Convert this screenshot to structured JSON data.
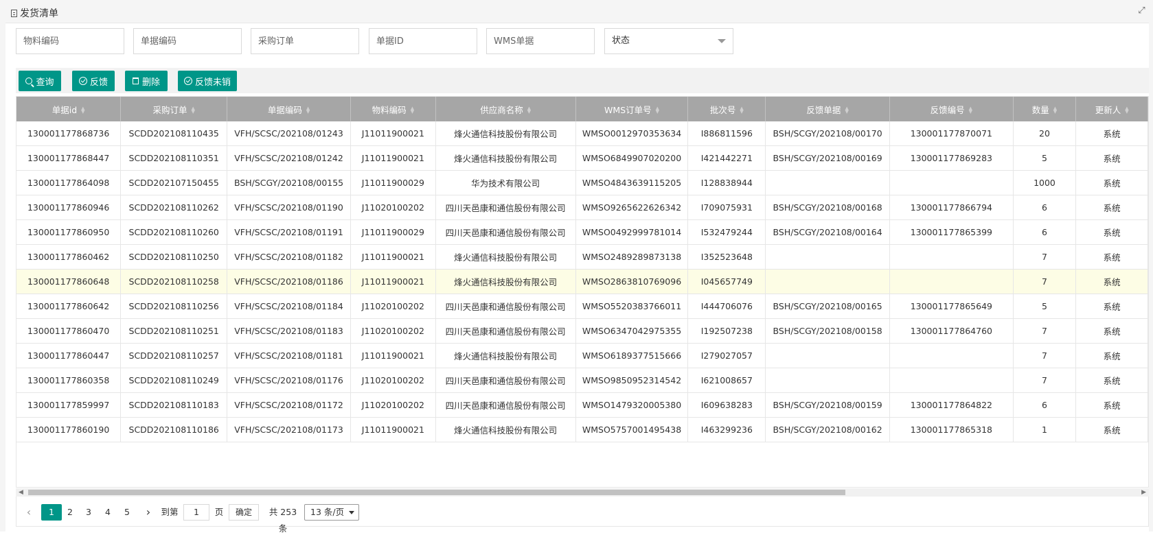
{
  "header": {
    "title": "发货清单",
    "icon": "document-icon",
    "expand_icon": "fullscreen-icon"
  },
  "filters": {
    "material_code_placeholder": "物料编码",
    "doc_code_placeholder": "单据编码",
    "purchase_order_placeholder": "采购订单",
    "doc_id_placeholder": "单据ID",
    "wms_doc_placeholder": "WMS单据",
    "status_label": "状态"
  },
  "toolbar": {
    "query_label": "查询",
    "feedback_label": "反馈",
    "delete_label": "删除",
    "feedback_pending_label": "反馈未销",
    "accent": "#009688"
  },
  "table": {
    "columns": [
      "单据id",
      "采购订单",
      "单据编码",
      "物料编码",
      "供应商名称",
      "WMS订单号",
      "批次号",
      "反馈单据",
      "反馈编号",
      "数量",
      "更新人"
    ],
    "rows": [
      [
        "130001177868736",
        "SCDD202108110435",
        "VFH/SCSC/202108/01243",
        "J11011900021",
        "烽火通信科技股份有限公司",
        "WMSO0012970353634",
        "I886811596",
        "BSH/SCGY/202108/00170",
        "130001177870071",
        "20",
        "系统"
      ],
      [
        "130001177868447",
        "SCDD202108110351",
        "VFH/SCSC/202108/01242",
        "J11011900021",
        "烽火通信科技股份有限公司",
        "WMSO6849907020200",
        "I421442271",
        "BSH/SCGY/202108/00169",
        "130001177869283",
        "5",
        "系统"
      ],
      [
        "130001177864098",
        "SCDD202107150455",
        "BSH/SCGY/202108/00155",
        "J11011900029",
        "华为技术有限公司",
        "WMSO4843639115205",
        "I128838944",
        "",
        "",
        "1000",
        "系统"
      ],
      [
        "130001177860946",
        "SCDD202108110262",
        "VFH/SCSC/202108/01190",
        "J11020100202",
        "四川天邑康和通信股份有限公司",
        "WMSO9265622626342",
        "I709075931",
        "BSH/SCGY/202108/00168",
        "130001177866794",
        "6",
        "系统"
      ],
      [
        "130001177860950",
        "SCDD202108110260",
        "VFH/SCSC/202108/01191",
        "J11011900029",
        "四川天邑康和通信股份有限公司",
        "WMSO0492999781014",
        "I532479244",
        "BSH/SCGY/202108/00164",
        "130001177865399",
        "6",
        "系统"
      ],
      [
        "130001177860462",
        "SCDD202108110250",
        "VFH/SCSC/202108/01182",
        "J11011900021",
        "烽火通信科技股份有限公司",
        "WMSO2489289873138",
        "I352523648",
        "",
        "",
        "7",
        "系统"
      ],
      [
        "130001177860648",
        "SCDD202108110258",
        "VFH/SCSC/202108/01186",
        "J11011900021",
        "烽火通信科技股份有限公司",
        "WMSO2863810769096",
        "I045657749",
        "",
        "",
        "7",
        "系统"
      ],
      [
        "130001177860642",
        "SCDD202108110256",
        "VFH/SCSC/202108/01184",
        "J11020100202",
        "四川天邑康和通信股份有限公司",
        "WMSO5520383766011",
        "I444706076",
        "BSH/SCGY/202108/00165",
        "130001177865649",
        "5",
        "系统"
      ],
      [
        "130001177860470",
        "SCDD202108110251",
        "VFH/SCSC/202108/01183",
        "J11020100202",
        "四川天邑康和通信股份有限公司",
        "WMSO6347042975355",
        "I192507238",
        "BSH/SCGY/202108/00158",
        "130001177864760",
        "7",
        "系统"
      ],
      [
        "130001177860447",
        "SCDD202108110257",
        "VFH/SCSC/202108/01181",
        "J11011900021",
        "烽火通信科技股份有限公司",
        "WMSO6189377515666",
        "I279027057",
        "",
        "",
        "7",
        "系统"
      ],
      [
        "130001177860358",
        "SCDD202108110249",
        "VFH/SCSC/202108/01176",
        "J11020100202",
        "四川天邑康和通信股份有限公司",
        "WMSO9850952314542",
        "I621008657",
        "",
        "",
        "7",
        "系统"
      ],
      [
        "130001177859997",
        "SCDD202108110183",
        "VFH/SCSC/202108/01172",
        "J11020100202",
        "四川天邑康和通信股份有限公司",
        "WMSO1479320005380",
        "I609638283",
        "BSH/SCGY/202108/00159",
        "130001177864822",
        "6",
        "系统"
      ],
      [
        "130001177860190",
        "SCDD202108110186",
        "VFH/SCSC/202108/01173",
        "J11011900021",
        "烽火通信科技股份有限公司",
        "WMSO5757001495438",
        "I463299236",
        "BSH/SCGY/202108/00162",
        "130001177865318",
        "1",
        "系统"
      ]
    ],
    "highlighted_row": 6
  },
  "pagination": {
    "pages": [
      "1",
      "2",
      "3",
      "4",
      "5"
    ],
    "current_page": "1",
    "goto_label": "到第",
    "goto_value": "1",
    "page_unit": "页",
    "confirm_label": "确定",
    "total_label": "共 253 条",
    "page_size": "13 条/页"
  }
}
